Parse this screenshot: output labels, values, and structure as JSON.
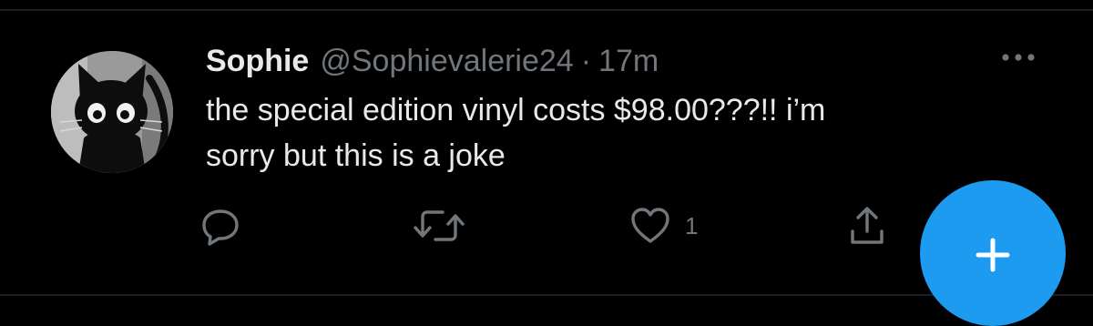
{
  "tweet": {
    "display_name": "Sophie",
    "handle": "@Sophievalerie24",
    "separator": "·",
    "timestamp": "17m",
    "text_line1": "the special edition vinyl costs $98.00???!! i’m",
    "text_line2": "sorry but this is a joke"
  },
  "actions": {
    "reply_icon": "reply-icon",
    "retweet_icon": "retweet-icon",
    "like_icon": "heart-icon",
    "like_count": "1",
    "share_icon": "share-icon"
  },
  "colors": {
    "background": "#000000",
    "text_primary": "#e7e9ea",
    "text_secondary": "#71767b",
    "accent": "#1d9bf0"
  }
}
